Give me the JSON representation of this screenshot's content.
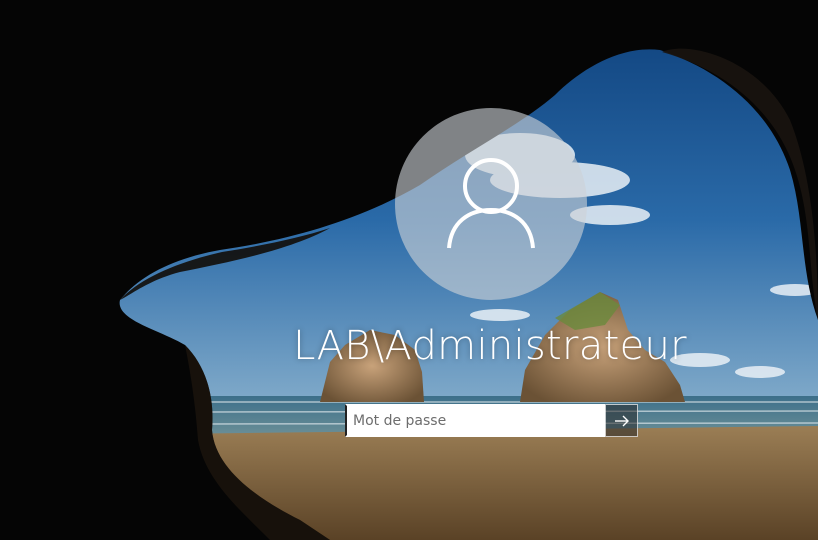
{
  "login": {
    "username": "LAB\\Administrateur",
    "password_placeholder": "Mot de passe",
    "password_value": ""
  },
  "icons": {
    "avatar": "user-icon",
    "submit": "arrow-right-icon"
  },
  "colors": {
    "sky": "#1f5a9a",
    "sand": "#8a6a40",
    "avatar_circle": "#cdd2d7"
  }
}
